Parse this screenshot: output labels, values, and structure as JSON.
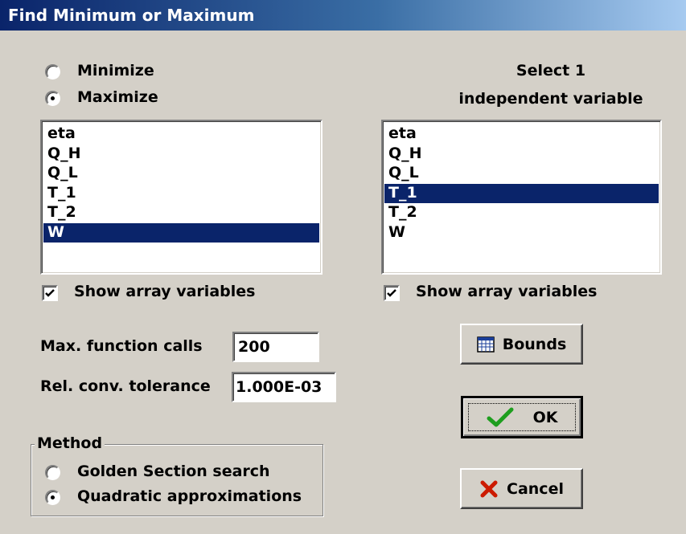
{
  "window": {
    "title": "Find Minimum or Maximum"
  },
  "objective": {
    "options": [
      {
        "label": "Minimize",
        "selected": false
      },
      {
        "label": "Maximize",
        "selected": true
      }
    ]
  },
  "left_list": {
    "items": [
      "eta",
      "Q_H",
      "Q_L",
      "T_1",
      "T_2",
      "W"
    ],
    "selected": "W"
  },
  "right_header": {
    "line1": "Select 1",
    "line2": "independent variable"
  },
  "right_list": {
    "items": [
      "eta",
      "Q_H",
      "Q_L",
      "T_1",
      "T_2",
      "W"
    ],
    "selected": "T_1"
  },
  "left_show_array": {
    "label": "Show array variables",
    "checked": true
  },
  "right_show_array": {
    "label": "Show array variables",
    "checked": true
  },
  "max_calls": {
    "label": "Max. function calls",
    "value": "200"
  },
  "tolerance": {
    "label": "Rel. conv. tolerance",
    "value": "1.000E-03"
  },
  "buttons": {
    "bounds": "Bounds",
    "ok": "OK",
    "cancel": "Cancel"
  },
  "method": {
    "title": "Method",
    "options": [
      {
        "label": "Golden Section search",
        "selected": false
      },
      {
        "label": "Quadratic approximations",
        "selected": true
      }
    ]
  },
  "colors": {
    "selection": "#0a246a",
    "dialog": "#d4d0c8",
    "ok_check": "#1e9e1e",
    "cancel_x": "#cc1a00"
  }
}
